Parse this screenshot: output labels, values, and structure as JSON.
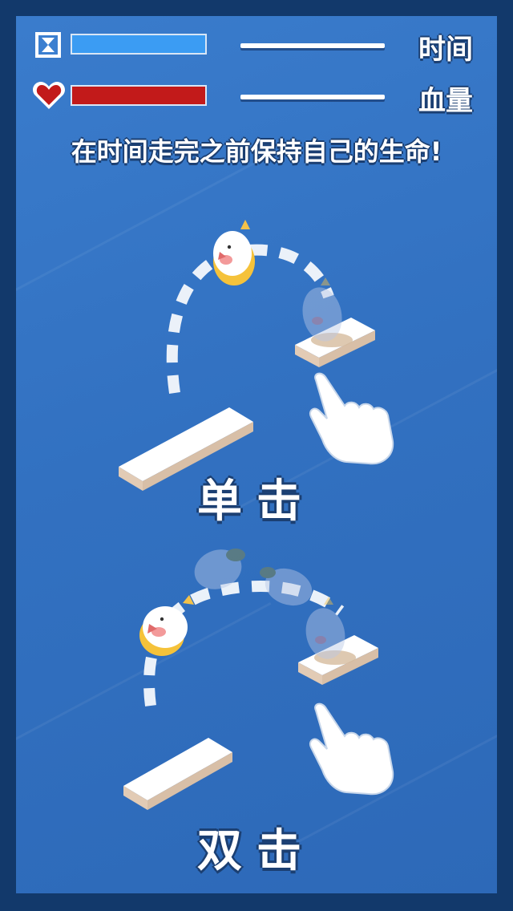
{
  "hud": {
    "time": {
      "label": "时间",
      "icon": "hourglass-icon",
      "fill_fraction": 1.0,
      "color": "#3b9cf3"
    },
    "health": {
      "label": "血量",
      "icon": "heart-icon",
      "fill_fraction": 1.0,
      "color": "#c21a1a"
    }
  },
  "instruction": "在时间走完之前保持自己的生命!",
  "tutorial": {
    "single_tap": {
      "label": "单击",
      "icon": "tap-hand-icon"
    },
    "double_tap": {
      "label": "双击",
      "icon": "tap-hand-icon"
    }
  },
  "colors": {
    "frame": "#12396b",
    "background": "#3271c1",
    "platform_top": "#ffffff",
    "platform_side": "#e2cbb5"
  }
}
